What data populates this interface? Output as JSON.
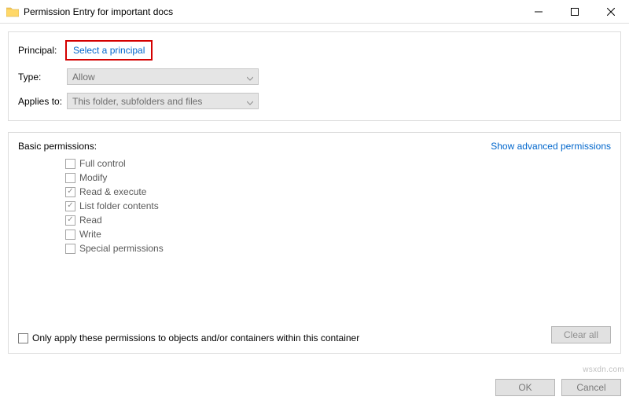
{
  "window": {
    "title": "Permission Entry for important docs"
  },
  "top": {
    "principal_label": "Principal:",
    "principal_link": "Select a principal",
    "type_label": "Type:",
    "type_value": "Allow",
    "applies_label": "Applies to:",
    "applies_value": "This folder, subfolders and files"
  },
  "basic": {
    "heading": "Basic permissions:",
    "show_advanced": "Show advanced permissions",
    "perms": [
      {
        "label": "Full control",
        "checked": false
      },
      {
        "label": "Modify",
        "checked": false
      },
      {
        "label": "Read & execute",
        "checked": true
      },
      {
        "label": "List folder contents",
        "checked": true
      },
      {
        "label": "Read",
        "checked": true
      },
      {
        "label": "Write",
        "checked": false
      },
      {
        "label": "Special permissions",
        "checked": false
      }
    ],
    "only_apply": "Only apply these permissions to objects and/or containers within this container",
    "clear_all": "Clear all"
  },
  "footer": {
    "ok": "OK",
    "cancel": "Cancel"
  },
  "watermark": "wsxdn.com"
}
